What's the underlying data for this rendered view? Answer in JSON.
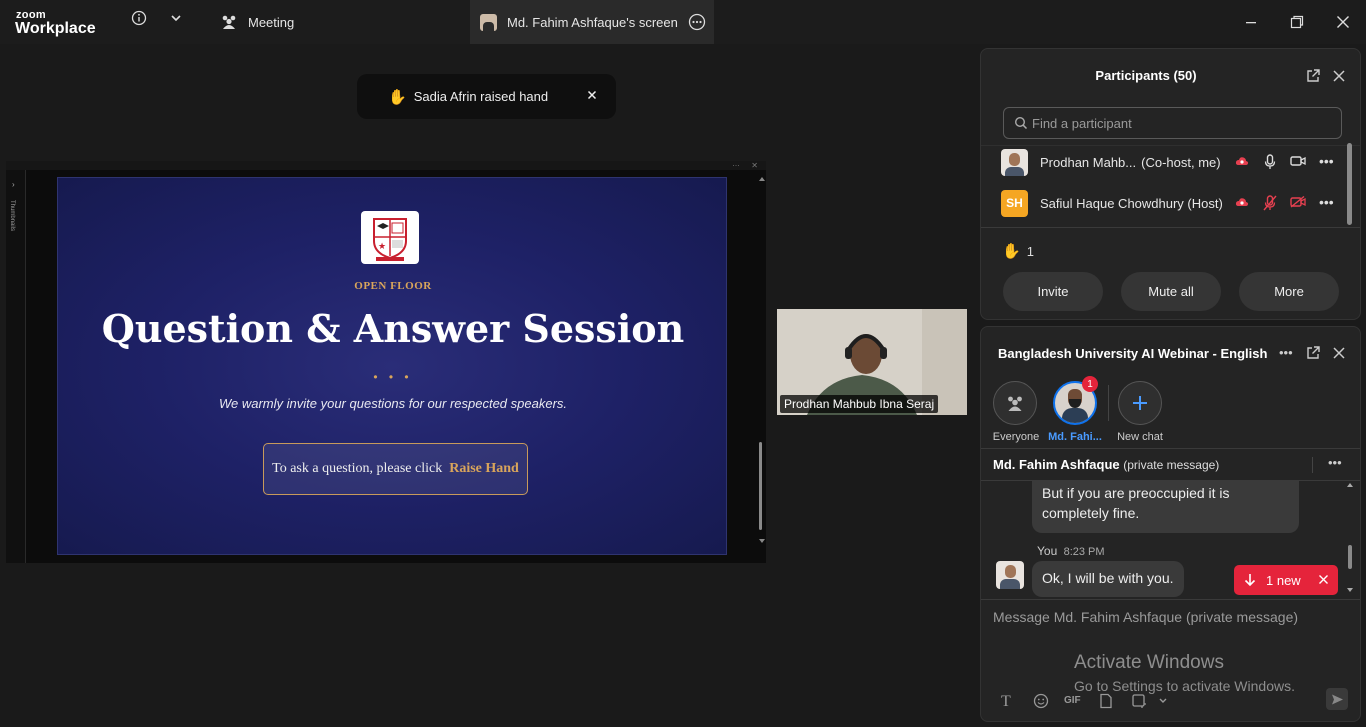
{
  "app": {
    "brand_top": "zoom",
    "brand_bottom": "Workplace"
  },
  "tabs": [
    {
      "label": "Meeting",
      "icon": "people-icon"
    },
    {
      "label": "Md. Fahim Ashfaque's screen",
      "icon": "avatar"
    }
  ],
  "toast": {
    "text": "Sadia Afrin raised hand",
    "icon": "raised-hand-icon"
  },
  "slide": {
    "kicker": "OPEN FLOOR",
    "title": "Question & Answer Session",
    "dots": "• • •",
    "subtitle": "We warmly invite your questions for our respected speakers.",
    "box_text": "To ask a question, please click",
    "box_highlight": "Raise Hand",
    "thumbnails_label": "Thumbnails"
  },
  "video": {
    "name": "Prodhan Mahbub Ibna Seraj"
  },
  "participants": {
    "title": "Participants (50)",
    "search_placeholder": "Find a participant",
    "rows": [
      {
        "name": "Prodhan Mahb...",
        "role": "(Co-host, me)",
        "mic": "on",
        "video": "on"
      },
      {
        "name": "Safiul Haque Chowdhury (Host)",
        "initials": "SH",
        "mic": "muted",
        "video": "off"
      }
    ],
    "raised_count": "1",
    "buttons": {
      "invite": "Invite",
      "mute_all": "Mute all",
      "more": "More"
    }
  },
  "chat": {
    "title": "Bangladesh University AI Webinar - English",
    "chips": [
      {
        "label": "Everyone"
      },
      {
        "label": "Md. Fahi...",
        "badge": "1"
      },
      {
        "label": "New chat"
      }
    ],
    "thread_name": "Md. Fahim Ashfaque",
    "thread_suffix": "(private message)",
    "messages": [
      {
        "text_line1": "But if you are preoccupied it is",
        "text_line2": "completely fine."
      },
      {
        "sender": "You",
        "time": "8:23 PM",
        "text": "Ok, I will be with you."
      }
    ],
    "new_badge": "1 new",
    "composer_placeholder": "Message Md. Fahim Ashfaque (private message)",
    "watermark_line1": "Activate Windows",
    "watermark_line2": "Go to Settings to activate Windows."
  },
  "colors": {
    "accent_blue": "#0e72ed",
    "alert_red": "#e5243b",
    "gold": "#d9a55b",
    "host_orange": "#f5a623"
  }
}
